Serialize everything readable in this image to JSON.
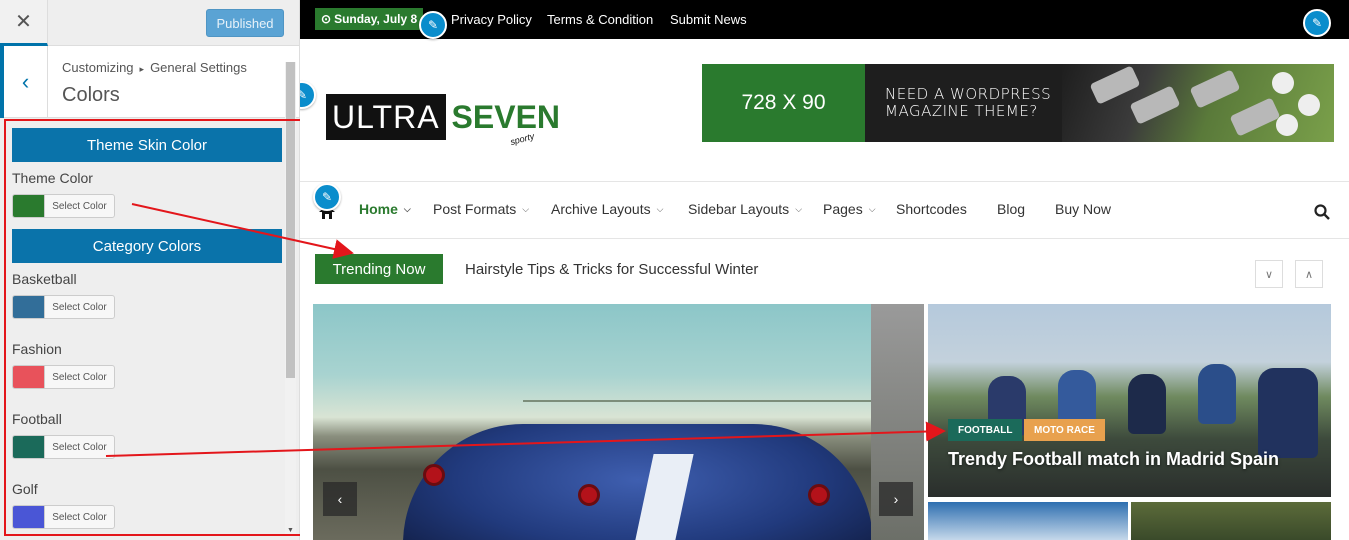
{
  "customizer": {
    "close_icon": "close-icon",
    "publish_label": "Published",
    "breadcrumb": [
      "Customizing",
      "General Settings"
    ],
    "breadcrumb_sep": "▸",
    "section_title": "Colors",
    "groups": [
      {
        "title": "Theme Skin Color",
        "controls": [
          {
            "label": "Theme Color",
            "color": "#2a7a2e",
            "button": "Select Color"
          }
        ]
      },
      {
        "title": "Category Colors",
        "controls": [
          {
            "label": "Basketball",
            "color": "#326e99",
            "button": "Select Color"
          },
          {
            "label": "Fashion",
            "color": "#e8525b",
            "button": "Select Color"
          },
          {
            "label": "Football",
            "color": "#1b6a5a",
            "button": "Select Color"
          },
          {
            "label": "Golf",
            "color": "#4a56d6",
            "button": "Select Color"
          }
        ]
      }
    ]
  },
  "site": {
    "date": "Sunday, July 8",
    "top_links": [
      "Privacy Policy",
      "Terms & Condition",
      "Submit News"
    ],
    "logo": {
      "word1": "ULTRA",
      "word2": "SEVEN",
      "tagline": "sporty"
    },
    "ad": {
      "size": "728 X 90",
      "line1": "NEED A WORDPRESS",
      "line2": "MAGAZINE THEME?"
    },
    "nav": [
      {
        "label": "Home",
        "has_children": true
      },
      {
        "label": "Post Formats",
        "has_children": true
      },
      {
        "label": "Archive Layouts",
        "has_children": true
      },
      {
        "label": "Sidebar Layouts",
        "has_children": true
      },
      {
        "label": "Pages",
        "has_children": true
      },
      {
        "label": "Shortcodes",
        "has_children": false
      },
      {
        "label": "Blog",
        "has_children": false
      },
      {
        "label": "Buy Now",
        "has_children": false
      }
    ],
    "trending_label": "Trending Now",
    "trending_headline": "Hairstyle Tips & Tricks for Successful Winter",
    "feature": {
      "categories": [
        {
          "name": "FOOTBALL",
          "color": "#1b6a5a"
        },
        {
          "name": "MOTO RACE",
          "color": "#e8a14e"
        }
      ],
      "title": "Trendy Football match in Madrid Spain"
    }
  },
  "colors": {
    "accent": "#0a73aa",
    "brand_green": "#2a7a2e",
    "annotation_red": "#e3161b"
  }
}
